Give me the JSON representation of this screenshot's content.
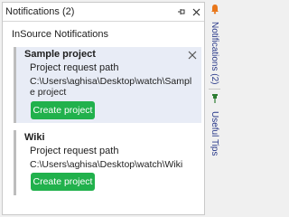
{
  "window": {
    "title": "Notifications (2)"
  },
  "panel": {
    "header": "InSource Notifications",
    "notifications": [
      {
        "title": "Sample project",
        "subtitle": "Project request path",
        "path": "C:\\Users\\aghisa\\Desktop\\watch\\Sample project",
        "button_label": "Create project"
      },
      {
        "title": "Wiki",
        "subtitle": "Project request path",
        "path": "C:\\Users\\aghisa\\Desktop\\watch\\Wiki",
        "button_label": "Create project"
      }
    ]
  },
  "side_tabs": [
    {
      "label": "Notifications (2)",
      "icon": "bell-icon"
    },
    {
      "label": "Useful Tips",
      "icon": "pin-icon"
    }
  ],
  "colors": {
    "accent_button": "#21b14c",
    "active_card_bg": "#e8ecf6",
    "side_tab_text": "#2a3a8a",
    "bell_orange": "#e8761a"
  }
}
